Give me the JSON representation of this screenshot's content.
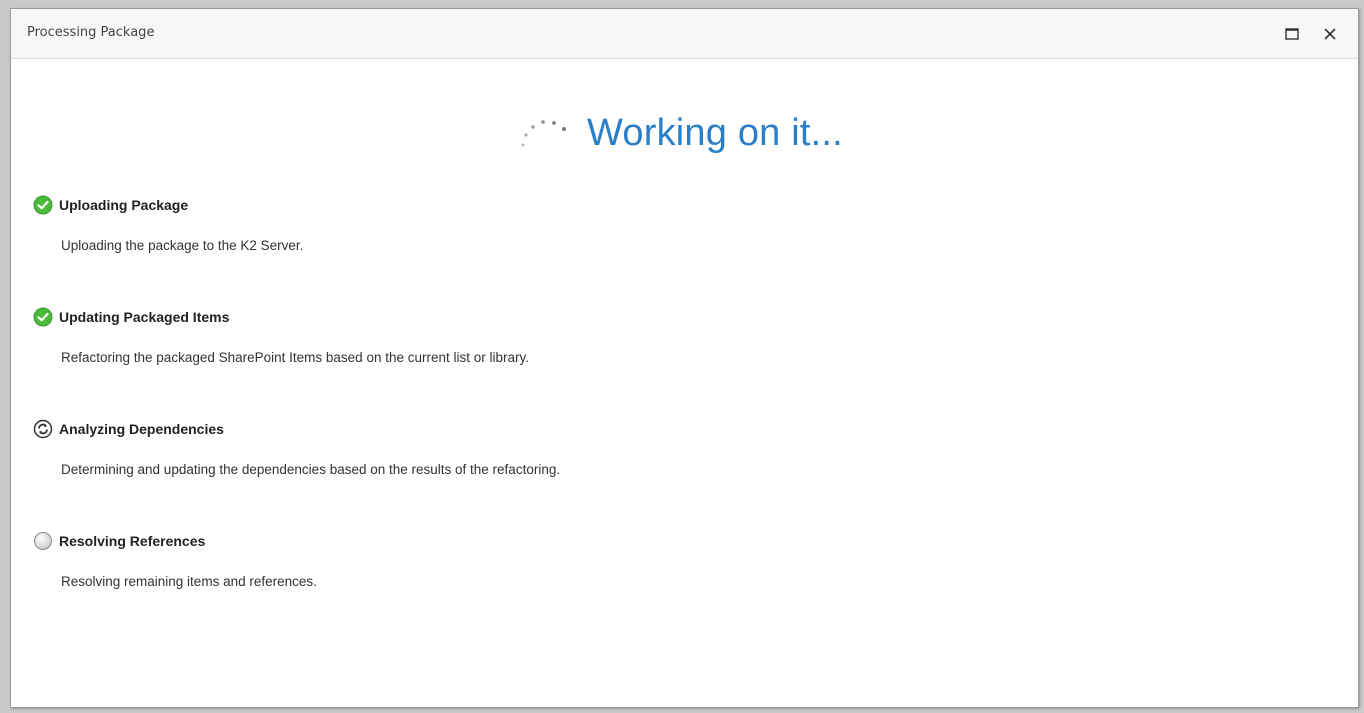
{
  "window": {
    "title": "Processing Package"
  },
  "status": {
    "heading": "Working on it...",
    "accent_color": "#2a7fc8"
  },
  "steps": [
    {
      "title": "Uploading Package",
      "description": "Uploading the package to the K2 Server.",
      "state": "complete",
      "icon": "check-circle-icon"
    },
    {
      "title": "Updating Packaged Items",
      "description": "Refactoring the packaged SharePoint Items based on the current list or library.",
      "state": "complete",
      "icon": "check-circle-icon"
    },
    {
      "title": "Analyzing Dependencies",
      "description": "Determining and updating the dependencies based on the results of the refactoring.",
      "state": "in-progress",
      "icon": "refresh-circle-icon"
    },
    {
      "title": "Resolving References",
      "description": "Resolving remaining items and references.",
      "state": "pending",
      "icon": "empty-circle-icon"
    }
  ]
}
